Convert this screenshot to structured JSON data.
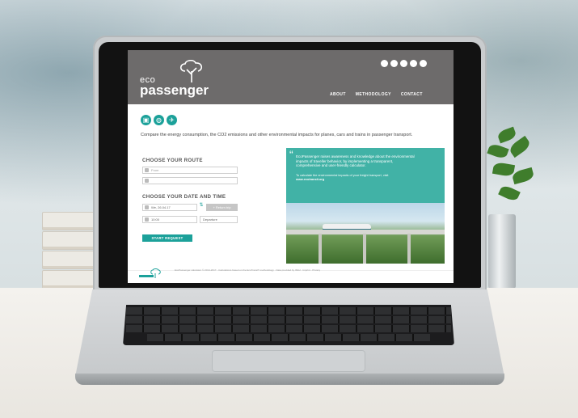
{
  "site": {
    "logo": {
      "line1": "eco",
      "line2": "passenger"
    },
    "nav": [
      "ABOUT",
      "METHODOLOGY",
      "CONTACT"
    ],
    "social_icons": [
      "social-icon-1",
      "social-icon-2",
      "social-icon-3",
      "social-icon-4",
      "social-icon-5"
    ],
    "transport_modes": [
      {
        "icon": "train-icon",
        "glyph": "▣"
      },
      {
        "icon": "car-icon",
        "glyph": "◍"
      },
      {
        "icon": "plane-icon",
        "glyph": "✈"
      }
    ],
    "intro": "Compare the energy consumption, the CO2 emissions and other environmental impacts for planes, cars and trains in passenger transport.",
    "route": {
      "title": "CHOOSE YOUR ROUTE",
      "from_placeholder": "From",
      "to_placeholder": "",
      "swap_glyph": "⇅"
    },
    "datetime": {
      "title": "CHOOSE YOUR DATE AND TIME",
      "date_value": "We, 26.04.17",
      "return_label": "+ Return trip",
      "time_value": "10:00",
      "time_mode": "Departure",
      "swap_glyph": "⇅"
    },
    "start_button": "START REQUEST",
    "quote": {
      "mark": "“",
      "text": "EcoPassenger raises awareness and knowledge about the environmental impacts of traveller behavior, by implementing a transparent, comprehensive and user-friendly calculator.",
      "sub": "To calculate the environmental impacts of your freight transport, visit",
      "link": "www.ecotransit.org"
    },
    "footer": {
      "logo": "eco passenger",
      "text": "EcoPassenger calculator © 2014-2017 · Calculations based on the EcoTransIT methodology · Data provided by IFEU · Imprint · Privacy"
    }
  },
  "colors": {
    "accent": "#1ca19a",
    "header": "#6d6b6b",
    "quote_bg": "#41b2a6"
  }
}
